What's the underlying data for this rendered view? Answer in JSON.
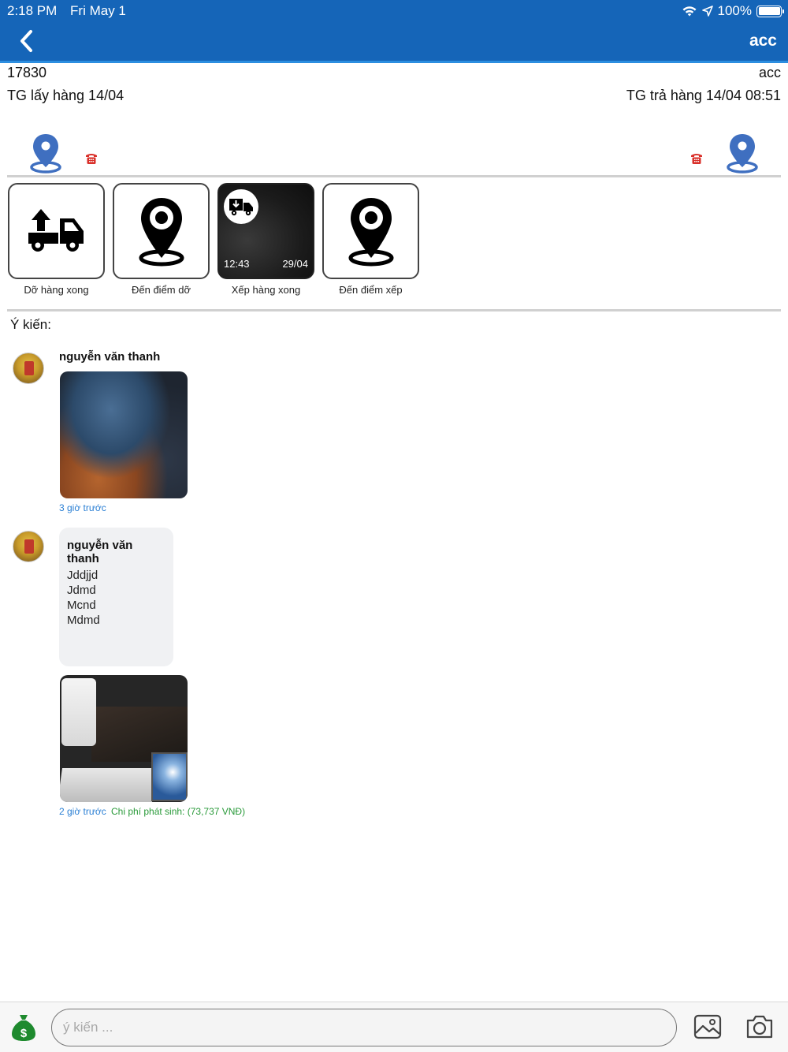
{
  "status_bar": {
    "time": "2:18 PM",
    "date": "Fri May 1",
    "battery": "100%"
  },
  "nav": {
    "title": "acc"
  },
  "order": {
    "id": "17830",
    "account": "acc",
    "pickup_time": "TG lấy hàng 14/04",
    "delivery_time": "TG trả hàng 14/04 08:51"
  },
  "actions": [
    {
      "label": "Dỡ hàng xong",
      "icon": "truck-unload-icon"
    },
    {
      "label": "Đến điểm dỡ",
      "icon": "location-pin-icon"
    },
    {
      "label": "Xếp hàng xong",
      "icon": "truck-load-icon",
      "photo_time": "12:43",
      "photo_date": "29/04"
    },
    {
      "label": "Đến điểm xếp",
      "icon": "location-pin-icon"
    }
  ],
  "comments_section": {
    "title": "Ý kiến:",
    "items": [
      {
        "author": "nguyễn văn thanh",
        "time": "3 giờ trước"
      },
      {
        "author": "nguyễn văn thanh",
        "lines": [
          "Jddjjd",
          "Jdmd",
          "Mcnd",
          "Mdmd"
        ],
        "time": "2 giờ trước",
        "cost": "Chi phí phát sinh: (73,737 VNĐ)"
      }
    ]
  },
  "composer": {
    "placeholder": "ý kiến ..."
  },
  "colors": {
    "header": "#1565b8",
    "pin": "#3f6fc0",
    "phone": "#d9302a",
    "link": "#2a7fd4",
    "cost": "#2a9a3a"
  }
}
